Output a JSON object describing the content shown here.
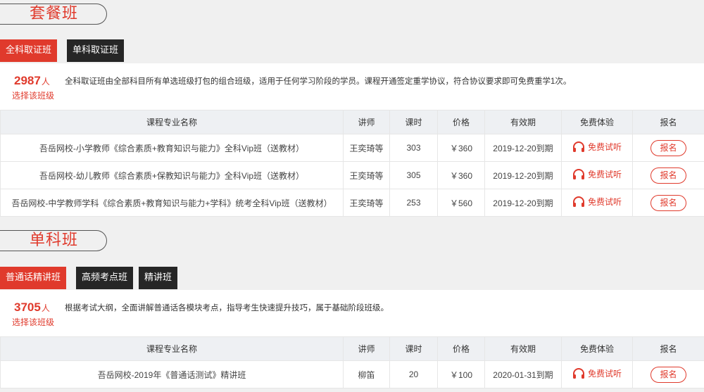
{
  "section1": {
    "title": "套餐班",
    "tabs": [
      "全科取证班",
      "单科取证班"
    ],
    "count": "2987",
    "unit": "人",
    "choose": "选择该班级",
    "desc": "全科取证班由全部科目所有单选班级打包的组合班级，适用于任何学习阶段的学员。课程开通签定重学协议，符合协议要求即可免费重学1次。",
    "headers": [
      "课程专业名称",
      "讲师",
      "课时",
      "价格",
      "有效期",
      "免费体验",
      "报名"
    ],
    "rows": [
      {
        "name": "吾岳网校-小学教师《综合素质+教育知识与能力》全科Vip班（送教材）",
        "teacher": "王奕琦等",
        "hours": "303",
        "price": "￥360",
        "valid": "2019-12-20到期",
        "trial": "免费试听",
        "enroll": "报名"
      },
      {
        "name": "吾岳网校-幼儿教师《综合素质+保教知识与能力》全科Vip班（送教材）",
        "teacher": "王奕琦等",
        "hours": "305",
        "price": "￥360",
        "valid": "2019-12-20到期",
        "trial": "免费试听",
        "enroll": "报名"
      },
      {
        "name": "吾岳网校-中学教师学科《综合素质+教育知识与能力+学科》统考全科Vip班（送教材）",
        "teacher": "王奕琦等",
        "hours": "253",
        "price": "￥560",
        "valid": "2019-12-20到期",
        "trial": "免费试听",
        "enroll": "报名"
      }
    ]
  },
  "section2": {
    "title": "单科班",
    "tabs": [
      "普通话精讲班",
      "高频考点班",
      "精讲班"
    ],
    "count": "3705",
    "unit": "人",
    "choose": "选择该班级",
    "desc": "根据考试大纲，全面讲解普通话各模块考点，指导考生快速提升技巧，属于基础阶段班级。",
    "headers": [
      "课程专业名称",
      "讲师",
      "课时",
      "价格",
      "有效期",
      "免费体验",
      "报名"
    ],
    "rows": [
      {
        "name": "吾岳网校-2019年《普通话测试》精讲班",
        "teacher": "柳笛",
        "hours": "20",
        "price": "￥100",
        "valid": "2020-01-31到期",
        "trial": "免费试听",
        "enroll": "报名"
      }
    ]
  },
  "colors": {
    "accent": "#e03a2c",
    "dark_tab": "#262626",
    "header_bg": "#eef0f3"
  }
}
